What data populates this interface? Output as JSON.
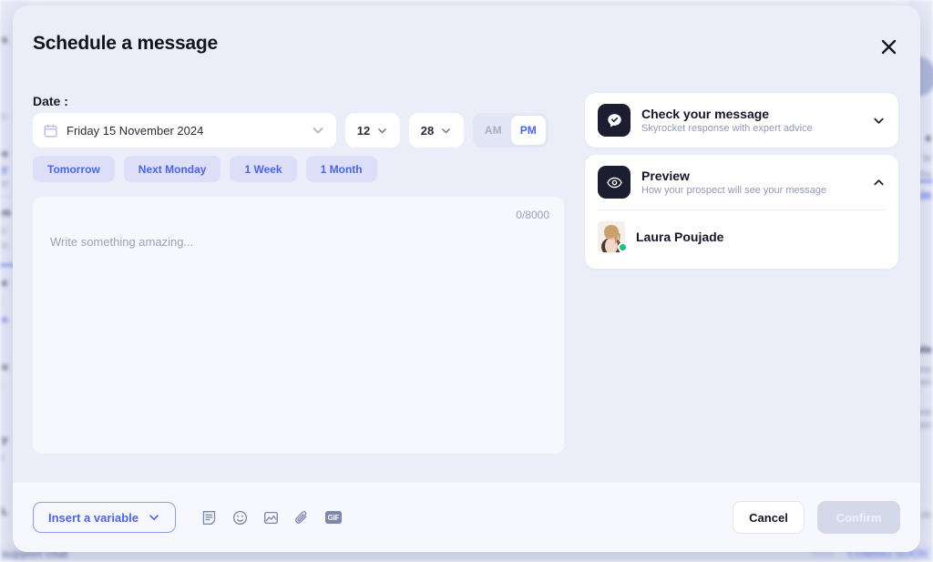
{
  "modal": {
    "title": "Schedule a message",
    "close_icon": "close-icon",
    "date_section_label": "Date :",
    "date_value": "Friday 15 November 2024",
    "hour_value": "12",
    "minute_value": "28",
    "meridiem": {
      "am_label": "AM",
      "pm_label": "PM",
      "selected": "PM"
    },
    "quick_dates": [
      {
        "label": "Tomorrow"
      },
      {
        "label": "Next Monday"
      },
      {
        "label": "1 Week"
      },
      {
        "label": "1 Month"
      }
    ],
    "editor": {
      "placeholder": "Write something amazing...",
      "counter": "0/8000"
    },
    "panel_cards": [
      {
        "title": "Check your message",
        "subtitle": "Skyrocket response with expert advice",
        "icon": "chat-check-icon",
        "expanded": false,
        "chevron": "chevron-down-icon"
      },
      {
        "title": "Preview",
        "subtitle": "How your prospect will see your message",
        "icon": "eye-icon",
        "expanded": true,
        "chevron": "chevron-up-icon"
      }
    ],
    "preview": {
      "contact_name": "Laura Poujade",
      "status": "online"
    },
    "footer": {
      "insert_variable_label": "Insert a variable",
      "tools": [
        {
          "name": "template-icon"
        },
        {
          "name": "emoji-icon"
        },
        {
          "name": "image-icon"
        },
        {
          "name": "attachment-icon"
        },
        {
          "name": "gif-icon",
          "label": "GIF"
        }
      ],
      "cancel_label": "Cancel",
      "confirm_label": "Confirm",
      "confirm_disabled": true
    }
  },
  "background": {
    "bottom_left_text": "support chat",
    "note_text": "Note",
    "coming_soon_text": "COMING SOON",
    "fragments_left": [
      "s",
      "c",
      "o",
      "y",
      "e",
      "m",
      "c",
      "n",
      "e",
      ":",
      "a",
      "u",
      ":",
      "y",
      "l",
      "L"
    ],
    "fragments_right": [
      "e",
      "le",
      "fre",
      "in",
      "ala",
      "ane",
      "von",
      "ane",
      "von",
      "nh"
    ]
  },
  "colors": {
    "accent": "#4a63f0",
    "modal_bg": "#ebedf9",
    "footer_bg": "#f7f8fd",
    "card_icon_bg": "#1c1d30",
    "status_online": "#19c37d",
    "chip_bg": "#dcdff7"
  }
}
